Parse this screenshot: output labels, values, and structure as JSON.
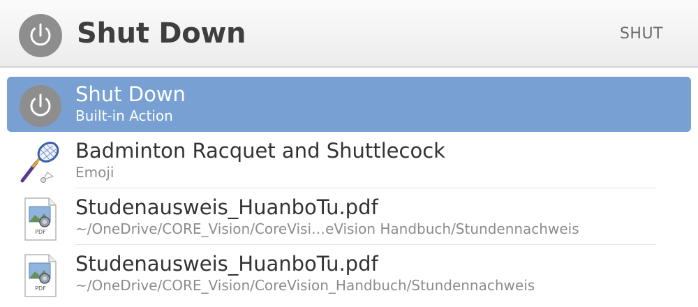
{
  "search": {
    "query": "Shut Down",
    "keyword_hint": "SHUT",
    "icon": "power-icon"
  },
  "results": [
    {
      "title": "Shut Down",
      "subtitle": "Built-in Action",
      "icon": "power-icon",
      "selected": true
    },
    {
      "title": "Badminton Racquet and Shuttlecock",
      "subtitle": "Emoji",
      "icon": "badminton-emoji-icon",
      "selected": false
    },
    {
      "title": "Studenausweis_HuanboTu.pdf",
      "subtitle": "~/OneDrive/CORE_Vision/CoreVisi…eVision Handbuch/Stundennachweis",
      "icon": "pdf-file-icon",
      "icon_label": "PDF",
      "selected": false
    },
    {
      "title": "Studenausweis_HuanboTu.pdf",
      "subtitle": "~/OneDrive/CORE_Vision/CoreVision_Handbuch/Stundennachweis",
      "icon": "pdf-file-icon",
      "icon_label": "PDF",
      "selected": false
    }
  ],
  "colors": {
    "selection": "#78a0d3",
    "power_icon_bg": "#8e8e8e"
  }
}
